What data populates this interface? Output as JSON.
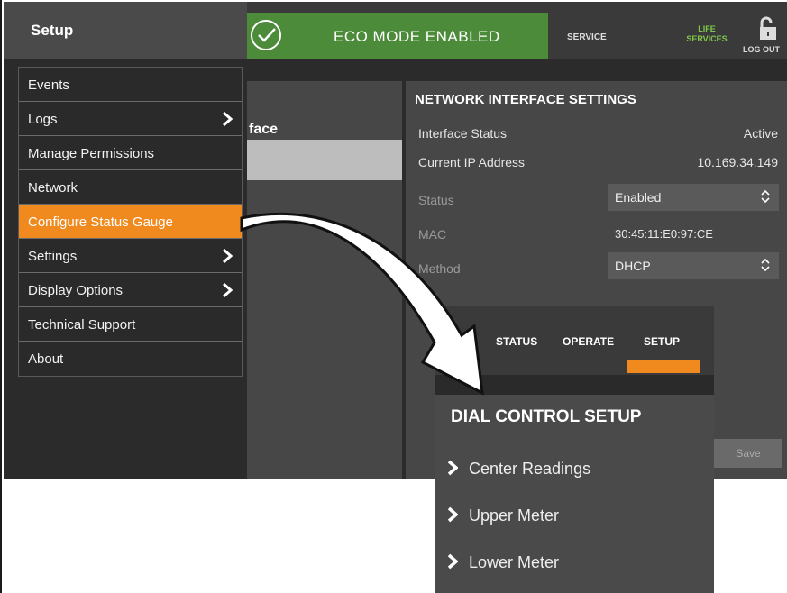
{
  "header": {
    "setup_title": "Setup",
    "eco_banner": "ECO MODE ENABLED",
    "service": "SERVICE",
    "life_services_line1": "LIFE",
    "life_services_line2": "SERVICES",
    "logout": "LOG OUT"
  },
  "menu": {
    "items": [
      {
        "label": "Events"
      },
      {
        "label": "Logs"
      },
      {
        "label": "Manage Permissions"
      },
      {
        "label": "Network"
      },
      {
        "label": "Configure Status Gauge"
      },
      {
        "label": "Settings"
      },
      {
        "label": "Display Options"
      },
      {
        "label": "Technical Support"
      },
      {
        "label": "About"
      }
    ]
  },
  "mid_panel": {
    "label": "face"
  },
  "network": {
    "title": "NETWORK INTERFACE SETTINGS",
    "interface_status_label": "Interface Status",
    "interface_status_value": "Active",
    "ip_label": "Current IP Address",
    "ip_value": "10.169.34.149",
    "status_label": "Status",
    "status_value": "Enabled",
    "mac_label": "MAC",
    "mac_value": "30:45:11:E0:97:CE",
    "method_label": "Method",
    "method_value": "DHCP",
    "save_label": "Save"
  },
  "mobile": {
    "tabs": [
      "STATUS",
      "OPERATE",
      "SETUP"
    ],
    "title": "DIAL CONTROL SETUP",
    "items": [
      "Center Readings",
      "Upper Meter",
      "Lower Meter"
    ]
  },
  "colors": {
    "accent": "#f08a1e",
    "eco_green": "#4c8b3a",
    "life_green": "#7ec94a"
  }
}
